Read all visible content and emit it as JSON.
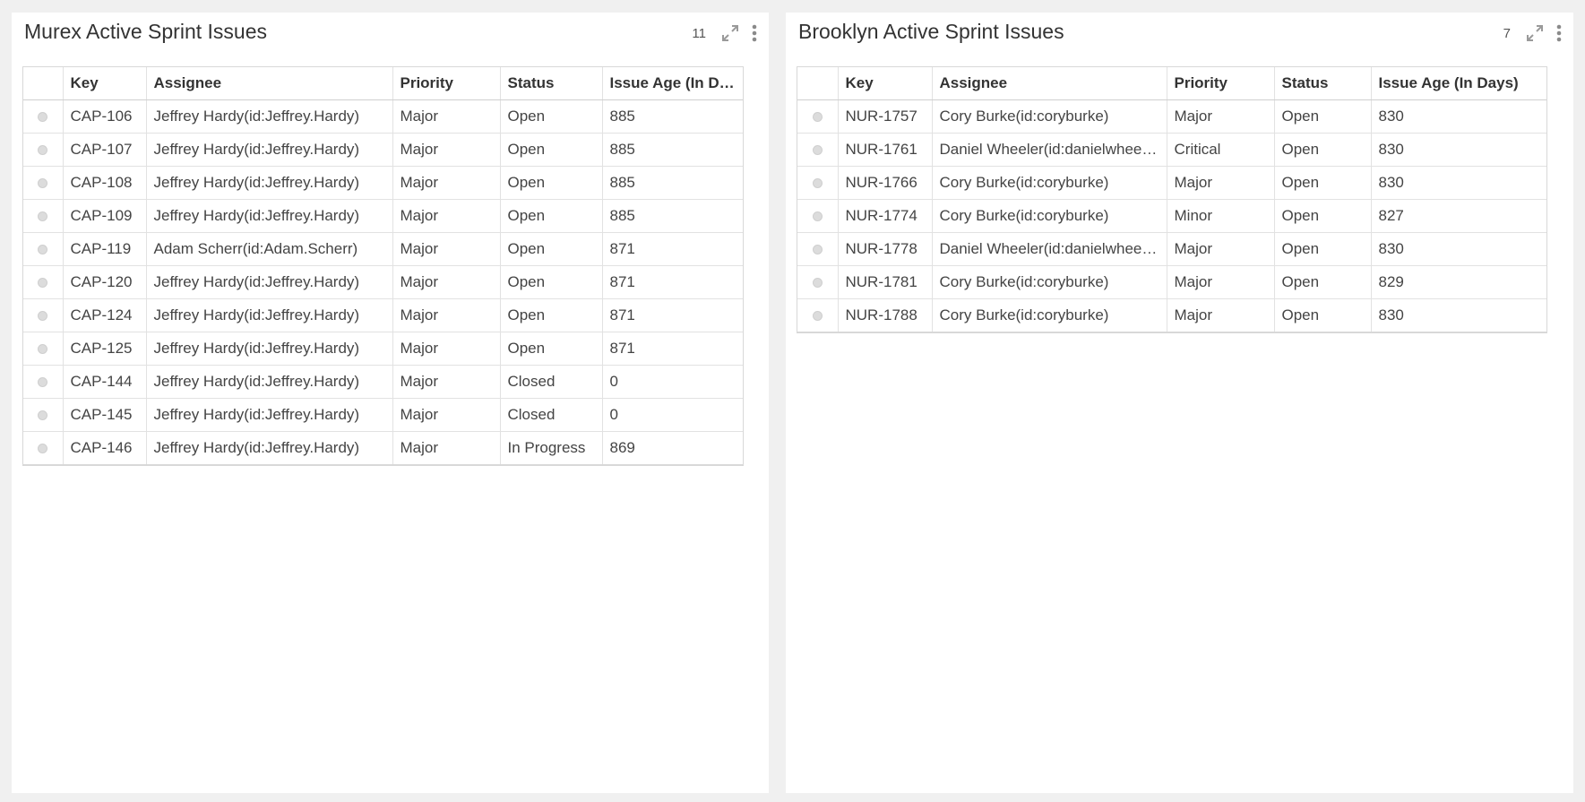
{
  "panels": [
    {
      "title": "Murex Active Sprint Issues",
      "count": "11",
      "icons": [
        "expand-icon",
        "more-vertical-icon"
      ],
      "columns": [
        "Key",
        "Assignee",
        "Priority",
        "Status",
        "Issue Age (In Days)"
      ],
      "rows": [
        {
          "key": "CAP-106",
          "assignee": "Jeffrey Hardy(id:Jeffrey.Hardy)",
          "priority": "Major",
          "status": "Open",
          "age": "885"
        },
        {
          "key": "CAP-107",
          "assignee": "Jeffrey Hardy(id:Jeffrey.Hardy)",
          "priority": "Major",
          "status": "Open",
          "age": "885"
        },
        {
          "key": "CAP-108",
          "assignee": "Jeffrey Hardy(id:Jeffrey.Hardy)",
          "priority": "Major",
          "status": "Open",
          "age": "885"
        },
        {
          "key": "CAP-109",
          "assignee": "Jeffrey Hardy(id:Jeffrey.Hardy)",
          "priority": "Major",
          "status": "Open",
          "age": "885"
        },
        {
          "key": "CAP-119",
          "assignee": "Adam Scherr(id:Adam.Scherr)",
          "priority": "Major",
          "status": "Open",
          "age": "871"
        },
        {
          "key": "CAP-120",
          "assignee": "Jeffrey Hardy(id:Jeffrey.Hardy)",
          "priority": "Major",
          "status": "Open",
          "age": "871"
        },
        {
          "key": "CAP-124",
          "assignee": "Jeffrey Hardy(id:Jeffrey.Hardy)",
          "priority": "Major",
          "status": "Open",
          "age": "871"
        },
        {
          "key": "CAP-125",
          "assignee": "Jeffrey Hardy(id:Jeffrey.Hardy)",
          "priority": "Major",
          "status": "Open",
          "age": "871"
        },
        {
          "key": "CAP-144",
          "assignee": "Jeffrey Hardy(id:Jeffrey.Hardy)",
          "priority": "Major",
          "status": "Closed",
          "age": "0"
        },
        {
          "key": "CAP-145",
          "assignee": "Jeffrey Hardy(id:Jeffrey.Hardy)",
          "priority": "Major",
          "status": "Closed",
          "age": "0"
        },
        {
          "key": "CAP-146",
          "assignee": "Jeffrey Hardy(id:Jeffrey.Hardy)",
          "priority": "Major",
          "status": "In Progress",
          "age": "869"
        }
      ]
    },
    {
      "title": "Brooklyn Active Sprint Issues",
      "count": "7",
      "icons": [
        "expand-icon",
        "more-vertical-icon"
      ],
      "columns": [
        "Key",
        "Assignee",
        "Priority",
        "Status",
        "Issue Age (In Days)"
      ],
      "rows": [
        {
          "key": "NUR-1757",
          "assignee": "Cory Burke(id:coryburke)",
          "priority": "Major",
          "status": "Open",
          "age": "830"
        },
        {
          "key": "NUR-1761",
          "assignee": "Daniel Wheeler(id:danielwheeler)",
          "priority": "Critical",
          "status": "Open",
          "age": "830"
        },
        {
          "key": "NUR-1766",
          "assignee": "Cory Burke(id:coryburke)",
          "priority": "Major",
          "status": "Open",
          "age": "830"
        },
        {
          "key": "NUR-1774",
          "assignee": "Cory Burke(id:coryburke)",
          "priority": "Minor",
          "status": "Open",
          "age": "827"
        },
        {
          "key": "NUR-1778",
          "assignee": "Daniel Wheeler(id:danielwheeler)",
          "priority": "Major",
          "status": "Open",
          "age": "830"
        },
        {
          "key": "NUR-1781",
          "assignee": "Cory Burke(id:coryburke)",
          "priority": "Major",
          "status": "Open",
          "age": "829"
        },
        {
          "key": "NUR-1788",
          "assignee": "Cory Burke(id:coryburke)",
          "priority": "Major",
          "status": "Open",
          "age": "830"
        }
      ]
    }
  ]
}
